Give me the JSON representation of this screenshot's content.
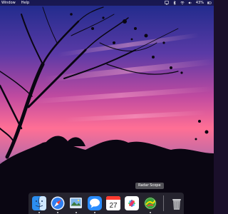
{
  "menubar": {
    "items": [
      "Window",
      "Help"
    ],
    "status": {
      "battery_percent": "43%",
      "icons": [
        "airplay-icon",
        "bluetooth-icon",
        "wifi-icon",
        "volume-icon",
        "battery-icon"
      ]
    }
  },
  "dock": {
    "tooltip": "Radar Scope",
    "apps": [
      {
        "name": "finder-icon",
        "running": true
      },
      {
        "name": "safari-icon",
        "running": true
      },
      {
        "name": "preview-icon",
        "running": true
      },
      {
        "name": "messages-icon",
        "running": true
      },
      {
        "name": "calendar-icon",
        "running": false,
        "date": "27"
      },
      {
        "name": "photos-icon",
        "running": false
      },
      {
        "name": "radarscope-icon",
        "running": true
      }
    ],
    "trash": {
      "name": "trash-icon"
    }
  },
  "wallpaper": {
    "description": "sunset-tree-silhouette",
    "colors": {
      "sky_top": "#2a2a8c",
      "sky_mid": "#7a4bb0",
      "sky_pink": "#ff6f95",
      "sky_low": "#e07aa0",
      "silhouette": "#0a0612"
    }
  }
}
